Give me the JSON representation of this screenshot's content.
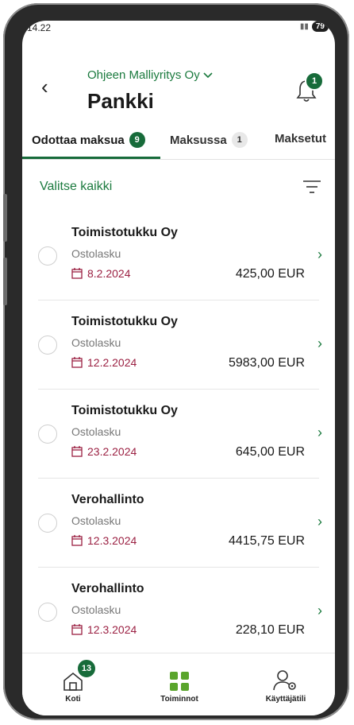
{
  "status": {
    "time": "14.22",
    "battery": "79"
  },
  "header": {
    "company": "Ohjeen Malliyritys Oy",
    "title": "Pankki",
    "notification_count": "1"
  },
  "tabs": [
    {
      "label": "Odottaa maksua",
      "count": "9"
    },
    {
      "label": "Maksussa",
      "count": "1"
    },
    {
      "label": "Maksetut",
      "count": ""
    }
  ],
  "select_all": "Valitse kaikki",
  "invoices": [
    {
      "name": "Toimistotukku Oy",
      "type": "Ostolasku",
      "date": "8.2.2024",
      "amount": "425,00 EUR"
    },
    {
      "name": "Toimistotukku Oy",
      "type": "Ostolasku",
      "date": "12.2.2024",
      "amount": "5983,00 EUR"
    },
    {
      "name": "Toimistotukku Oy",
      "type": "Ostolasku",
      "date": "23.2.2024",
      "amount": "645,00 EUR"
    },
    {
      "name": "Verohallinto",
      "type": "Ostolasku",
      "date": "12.3.2024",
      "amount": "4415,75 EUR"
    },
    {
      "name": "Verohallinto",
      "type": "Ostolasku",
      "date": "12.3.2024",
      "amount": "228,10 EUR"
    }
  ],
  "bottom_nav": [
    {
      "label": "Koti",
      "icon": "home-icon",
      "badge": "13"
    },
    {
      "label": "Toiminnot",
      "icon": "grid-icon",
      "badge": ""
    },
    {
      "label": "Käyttäjätili",
      "icon": "user-settings-icon",
      "badge": ""
    }
  ],
  "colors": {
    "accent": "#176b3a",
    "accent_text": "#1b7a3e",
    "date": "#9b2042"
  }
}
